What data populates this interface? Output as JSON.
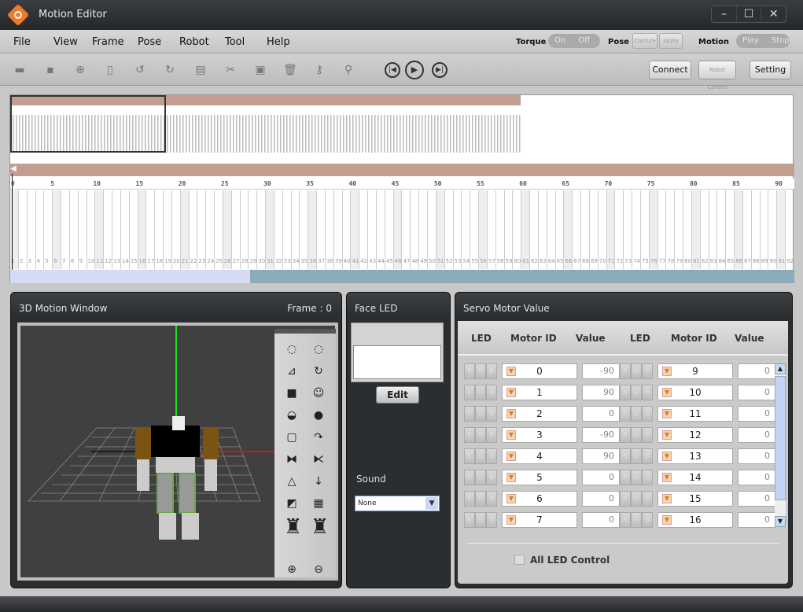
{
  "window": {
    "title": "Motion Editor",
    "controls": [
      "–",
      "☐",
      "✕"
    ]
  },
  "menu": {
    "items": [
      "File",
      "View",
      "Frame",
      "Pose",
      "Robot",
      "Tool",
      "Help"
    ],
    "torque_label": "Torque",
    "torque_on": "On",
    "torque_off": "Off",
    "pose_label": "Pose",
    "pose_capture": "Capture",
    "pose_apply": "Apply",
    "motion_label": "Motion",
    "motion_play": "Play",
    "motion_stop": "Stop"
  },
  "toolbar": {
    "icons": [
      {
        "name": "open-folder-icon",
        "glyph": "▬"
      },
      {
        "name": "save-icon",
        "glyph": "▪"
      },
      {
        "name": "add-icon",
        "glyph": "⊕"
      },
      {
        "name": "new-file-icon",
        "glyph": "▯"
      },
      {
        "name": "undo-icon",
        "glyph": "↺"
      },
      {
        "name": "redo-icon",
        "glyph": "↻"
      },
      {
        "name": "windows-icon",
        "glyph": "▤"
      },
      {
        "name": "cut-icon",
        "glyph": "✂"
      },
      {
        "name": "paste-icon",
        "glyph": "▣"
      },
      {
        "name": "delete-icon",
        "glyph": "🗑"
      },
      {
        "name": "key-icon",
        "glyph": "⚷"
      },
      {
        "name": "search-icon",
        "glyph": "⚲"
      }
    ],
    "prev_glyph": "|◀",
    "play_glyph": "▶",
    "next_glyph": "▶|",
    "connect": "Connect",
    "robot_control": "Robot Control",
    "setting": "Setting"
  },
  "timeline": {
    "ruler_ticks": [
      "0",
      "5",
      "10",
      "15",
      "20",
      "25",
      "30",
      "35",
      "40",
      "45",
      "50",
      "55",
      "60",
      "65",
      "70",
      "75",
      "80",
      "85",
      "90"
    ],
    "frame_count_visible": 92
  },
  "motion3d": {
    "title": "3D Motion Window",
    "frame_label": "Frame : 0",
    "tools": [
      "◌",
      "◌",
      "⊿",
      "↻",
      "■",
      "☺",
      "◒",
      "●",
      "▢",
      "↷",
      "⧓",
      "⧔",
      "△",
      "↓",
      "◩",
      "▦",
      "♜",
      "♜",
      "⊕",
      "⊖"
    ]
  },
  "face_led": {
    "title": "Face LED",
    "edit": "Edit",
    "sound_label": "Sound",
    "sound_value": "None"
  },
  "servo": {
    "title": "Servo Motor Value",
    "headers": {
      "led": "LED",
      "motor_id": "Motor ID",
      "value": "Value"
    },
    "left": [
      {
        "id": "0",
        "value": "-90"
      },
      {
        "id": "1",
        "value": "90"
      },
      {
        "id": "2",
        "value": "0"
      },
      {
        "id": "3",
        "value": "-90"
      },
      {
        "id": "4",
        "value": "90"
      },
      {
        "id": "5",
        "value": "0"
      },
      {
        "id": "6",
        "value": "0"
      },
      {
        "id": "7",
        "value": "0"
      }
    ],
    "right": [
      {
        "id": "9",
        "value": "0"
      },
      {
        "id": "10",
        "value": "0"
      },
      {
        "id": "11",
        "value": "0"
      },
      {
        "id": "12",
        "value": "0"
      },
      {
        "id": "13",
        "value": "0"
      },
      {
        "id": "14",
        "value": "0"
      },
      {
        "id": "15",
        "value": "0"
      },
      {
        "id": "16",
        "value": "0"
      }
    ],
    "rgb": [
      "R",
      "G",
      "B"
    ],
    "all_led": "All LED Control"
  }
}
